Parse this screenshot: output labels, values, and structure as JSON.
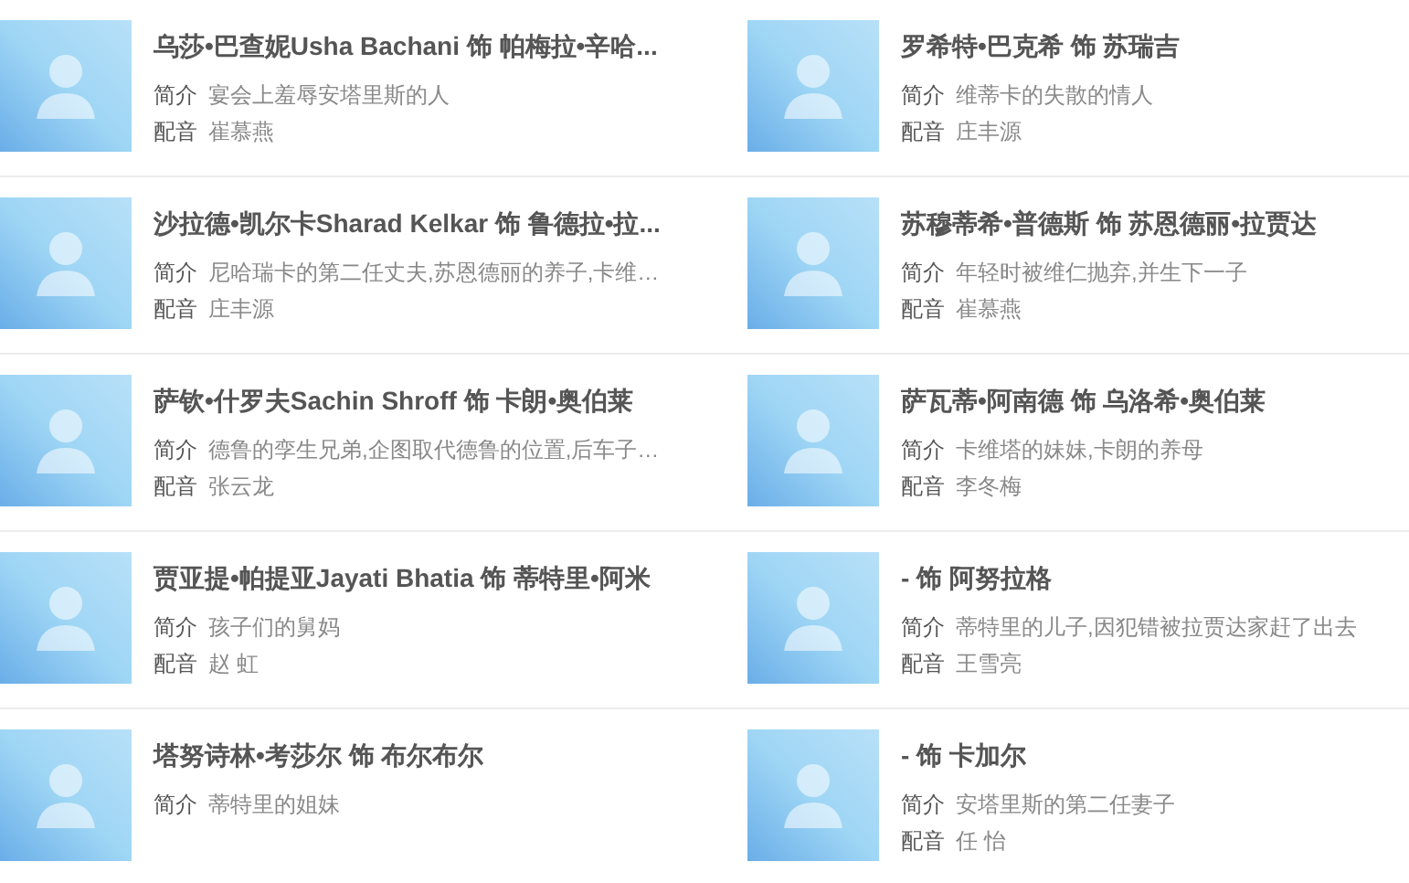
{
  "cast": [
    {
      "title": "乌莎•巴查妮Usha Bachani 饰 帕梅拉•辛哈...",
      "intro_label": "简介",
      "intro": "宴会上羞辱安塔里斯的人",
      "dub_label": "配音",
      "dub": "崔慕燕"
    },
    {
      "title": "罗希特•巴克希 饰 苏瑞吉",
      "intro_label": "简介",
      "intro": "维蒂卡的失散的情人",
      "dub_label": "配音",
      "dub": "庄丰源"
    },
    {
      "title": "沙拉德•凯尔卡Sharad Kelkar 饰 鲁德拉•拉...",
      "intro_label": "简介",
      "intro": "尼哈瑞卡的第二任丈夫,苏恩德丽的养子,卡维…",
      "dub_label": "配音",
      "dub": "庄丰源"
    },
    {
      "title": "苏穆蒂希•普德斯 饰 苏恩德丽•拉贾达",
      "intro_label": "简介",
      "intro": "年轻时被维仁抛弃,并生下一子",
      "dub_label": "配音",
      "dub": "崔慕燕"
    },
    {
      "title": "萨钦•什罗夫Sachin Shroff 饰 卡朗•奥伯莱",
      "intro_label": "简介",
      "intro": "德鲁的孪生兄弟,企图取代德鲁的位置,后车子…",
      "dub_label": "配音",
      "dub": "张云龙"
    },
    {
      "title": "萨瓦蒂•阿南德 饰 乌洛希•奥伯莱",
      "intro_label": "简介",
      "intro": "卡维塔的妹妹,卡朗的养母",
      "dub_label": "配音",
      "dub": "李冬梅"
    },
    {
      "title": "贾亚提•帕提亚Jayati Bhatia 饰 蒂特里•阿米",
      "intro_label": "简介",
      "intro": "孩子们的舅妈",
      "dub_label": "配音",
      "dub": "赵 虹"
    },
    {
      "title": "- 饰 阿努拉格",
      "intro_label": "简介",
      "intro": "蒂特里的儿子,因犯错被拉贾达家赶了出去",
      "dub_label": "配音",
      "dub": "王雪亮"
    },
    {
      "title": "塔努诗林•考莎尔 饰 布尔布尔",
      "intro_label": "简介",
      "intro": "蒂特里的姐妹"
    },
    {
      "title": "- 饰 卡加尔",
      "intro_label": "简介",
      "intro": "安塔里斯的第二任妻子",
      "dub_label": "配音",
      "dub": "任 怡"
    }
  ]
}
